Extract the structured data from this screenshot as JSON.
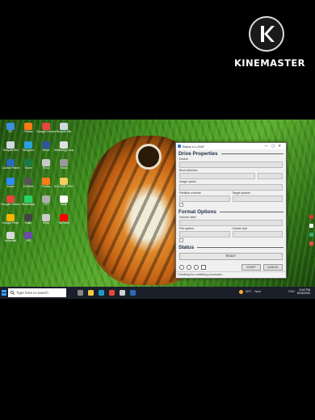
{
  "watermark": {
    "brand": "KINEMASTER",
    "logo_icon": "kinemaster-k-icon"
  },
  "desktop": {
    "wallpaper": "tiger-in-grass",
    "icons_col1": [
      "PC",
      "Recycle Bin",
      "Control Panel",
      "Zoom",
      "Google Chrome",
      "Google Drive",
      "composit"
    ],
    "icons_col2": [
      "Firefox",
      "Telegram",
      "Excel",
      "CSPrint",
      "WhatsApp",
      "Daily",
      "UPI"
    ],
    "icons_col3": [
      "Google Chrome",
      "Word",
      "Shop",
      "Firefox",
      "TBT",
      "Shop"
    ],
    "icons_col4": [
      "Recycle Bin",
      "WhatsApp Image",
      "Stock",
      "SCHOOL PROJECT",
      "Note",
      "YouTube"
    ]
  },
  "rufus": {
    "title": "Rufus 4.1.2047",
    "drive_properties": "Drive Properties",
    "device_label": "Device",
    "boot_selection_label": "Boot selection",
    "image_option_label": "Image option",
    "partition_scheme_label": "Partition scheme",
    "target_system_label": "Target system",
    "format_options": "Format Options",
    "volume_label_label": "Volume label",
    "file_system_label": "File system",
    "cluster_size_label": "Cluster size",
    "status": "Status",
    "ready": "READY",
    "start_button": "START",
    "cancel_button": "CANCEL",
    "statusbar_text": "Checking for conflicting processes..."
  },
  "taskbar": {
    "search_placeholder": "Type here to search",
    "weather": "28°C",
    "weather_text": "Haze",
    "lang": "ENG",
    "time": "8:42 PM",
    "date": "8/19/2023"
  }
}
